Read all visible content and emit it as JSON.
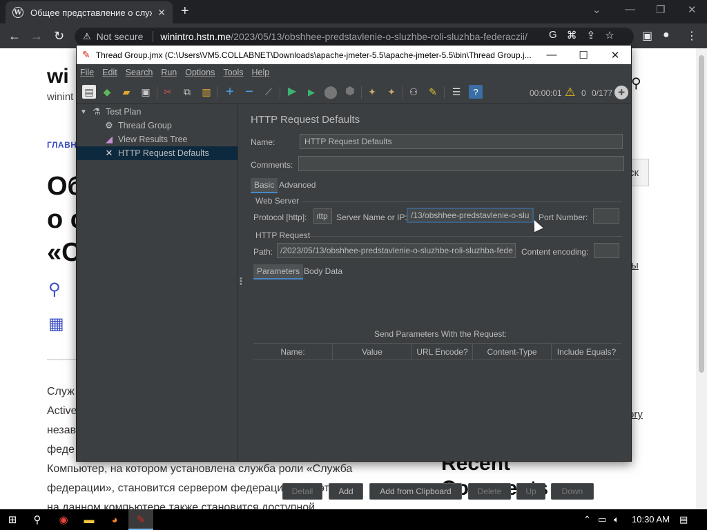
{
  "browser": {
    "tab_title": "Общее представление о служб",
    "tab_close": "✕",
    "new_tab": "+",
    "not_secure": "Not secure",
    "url_host": "winintro.hstn.me",
    "url_path": "/2023/05/13/obshhee-predstavlenie-o-sluzhbe-roli-sluzhba-federaczii/"
  },
  "webpage": {
    "site_title": "wi",
    "site_tagline": "winint",
    "breadcrumb": "ГЛАВН",
    "article_title_lines": [
      "Об",
      "о с",
      "«С"
    ],
    "body_lines": [
      "Служ",
      "Active",
      "незав",
      "феде",
      "Компьютер, на котором установлена служба роли «Служба",
      "федерации», становится сервером федерации. При этом",
      "на данном компьютере также становится доступной"
    ],
    "search_button": "ск",
    "side_link_1": "ы",
    "side_link_2": "к",
    "side_link_3": "ory",
    "recent_comments_1": "Recent",
    "recent_comments_2": "Comments"
  },
  "jmeter": {
    "window_title": "Thread Group.jmx (C:\\Users\\VM5.COLLABNET\\Downloads\\apache-jmeter-5.5\\apache-jmeter-5.5\\bin\\Thread Group.j...",
    "menu": [
      "File",
      "Edit",
      "Search",
      "Run",
      "Options",
      "Tools",
      "Help"
    ],
    "timer": "00:00:01",
    "error_count": "0",
    "threads": "0/177",
    "tree": [
      {
        "label": "Test Plan",
        "icon": "flask-icon"
      },
      {
        "label": "Thread Group",
        "icon": "gear-icon"
      },
      {
        "label": "View Results Tree",
        "icon": "chart-icon"
      },
      {
        "label": "HTTP Request Defaults",
        "icon": "wrench-icon"
      }
    ],
    "panel_title": "HTTP Request Defaults",
    "name_label": "Name:",
    "name_value": "HTTP Request Defaults",
    "comments_label": "Comments:",
    "comments_value": "",
    "tabs": [
      "Basic",
      "Advanced"
    ],
    "web_server_label": "Web Server",
    "protocol_label": "Protocol [http]:",
    "protocol_value": "ıttp",
    "server_label": "Server Name or IP:",
    "server_value": "/13/obshhee-predstavlenie-o-slu",
    "port_label": "Port Number:",
    "port_value": "",
    "http_request_label": "HTTP Request",
    "path_label": "Path:",
    "path_value": "/2023/05/13/obshhee-predstavlenie-o-sluzhbe-roli-sluzhba-fede",
    "encoding_label": "Content encoding:",
    "encoding_value": "",
    "subtabs": [
      "Parameters",
      "Body Data"
    ],
    "send_params_label": "Send Parameters With the Request:",
    "columns": [
      "Name:",
      "Value",
      "URL Encode?",
      "Content-Type",
      "Include Equals?"
    ],
    "buttons": {
      "detail": "Detail",
      "add": "Add",
      "add_clipboard": "Add from Clipboard",
      "delete": "Delete",
      "up": "Up",
      "down": "Down"
    }
  },
  "taskbar": {
    "time": "10:30 AM"
  },
  "colors": {
    "jmeter_bg": "#3c3f41",
    "selection": "#0d293e",
    "accent_blue": "#3a4cc5"
  }
}
